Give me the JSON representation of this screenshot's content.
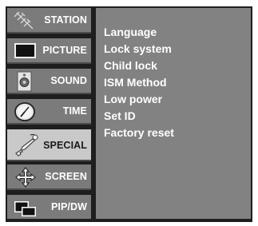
{
  "sidebar": {
    "tabs": [
      {
        "label": "STATION",
        "icon": "antenna-icon",
        "active": false
      },
      {
        "label": "PICTURE",
        "icon": "monitor-icon",
        "active": false
      },
      {
        "label": "SOUND",
        "icon": "speaker-icon",
        "active": false
      },
      {
        "label": "TIME",
        "icon": "clock-icon",
        "active": false
      },
      {
        "label": "SPECIAL",
        "icon": "key-icon",
        "active": true
      },
      {
        "label": "SCREEN",
        "icon": "move-arrows-icon",
        "active": false
      },
      {
        "label": "PIP/DW",
        "icon": "pip-icon",
        "active": false
      }
    ]
  },
  "menu": {
    "items": [
      "Language",
      "Lock system",
      "Child lock",
      "ISM Method",
      "Low power",
      "Set ID",
      "Factory reset"
    ]
  },
  "colors": {
    "tab_background": "#7b7b7b",
    "tab_active_background": "#c9c9c9",
    "panel_background": "#828282",
    "frame": "#1e1e1e",
    "text": "#ffffff"
  }
}
